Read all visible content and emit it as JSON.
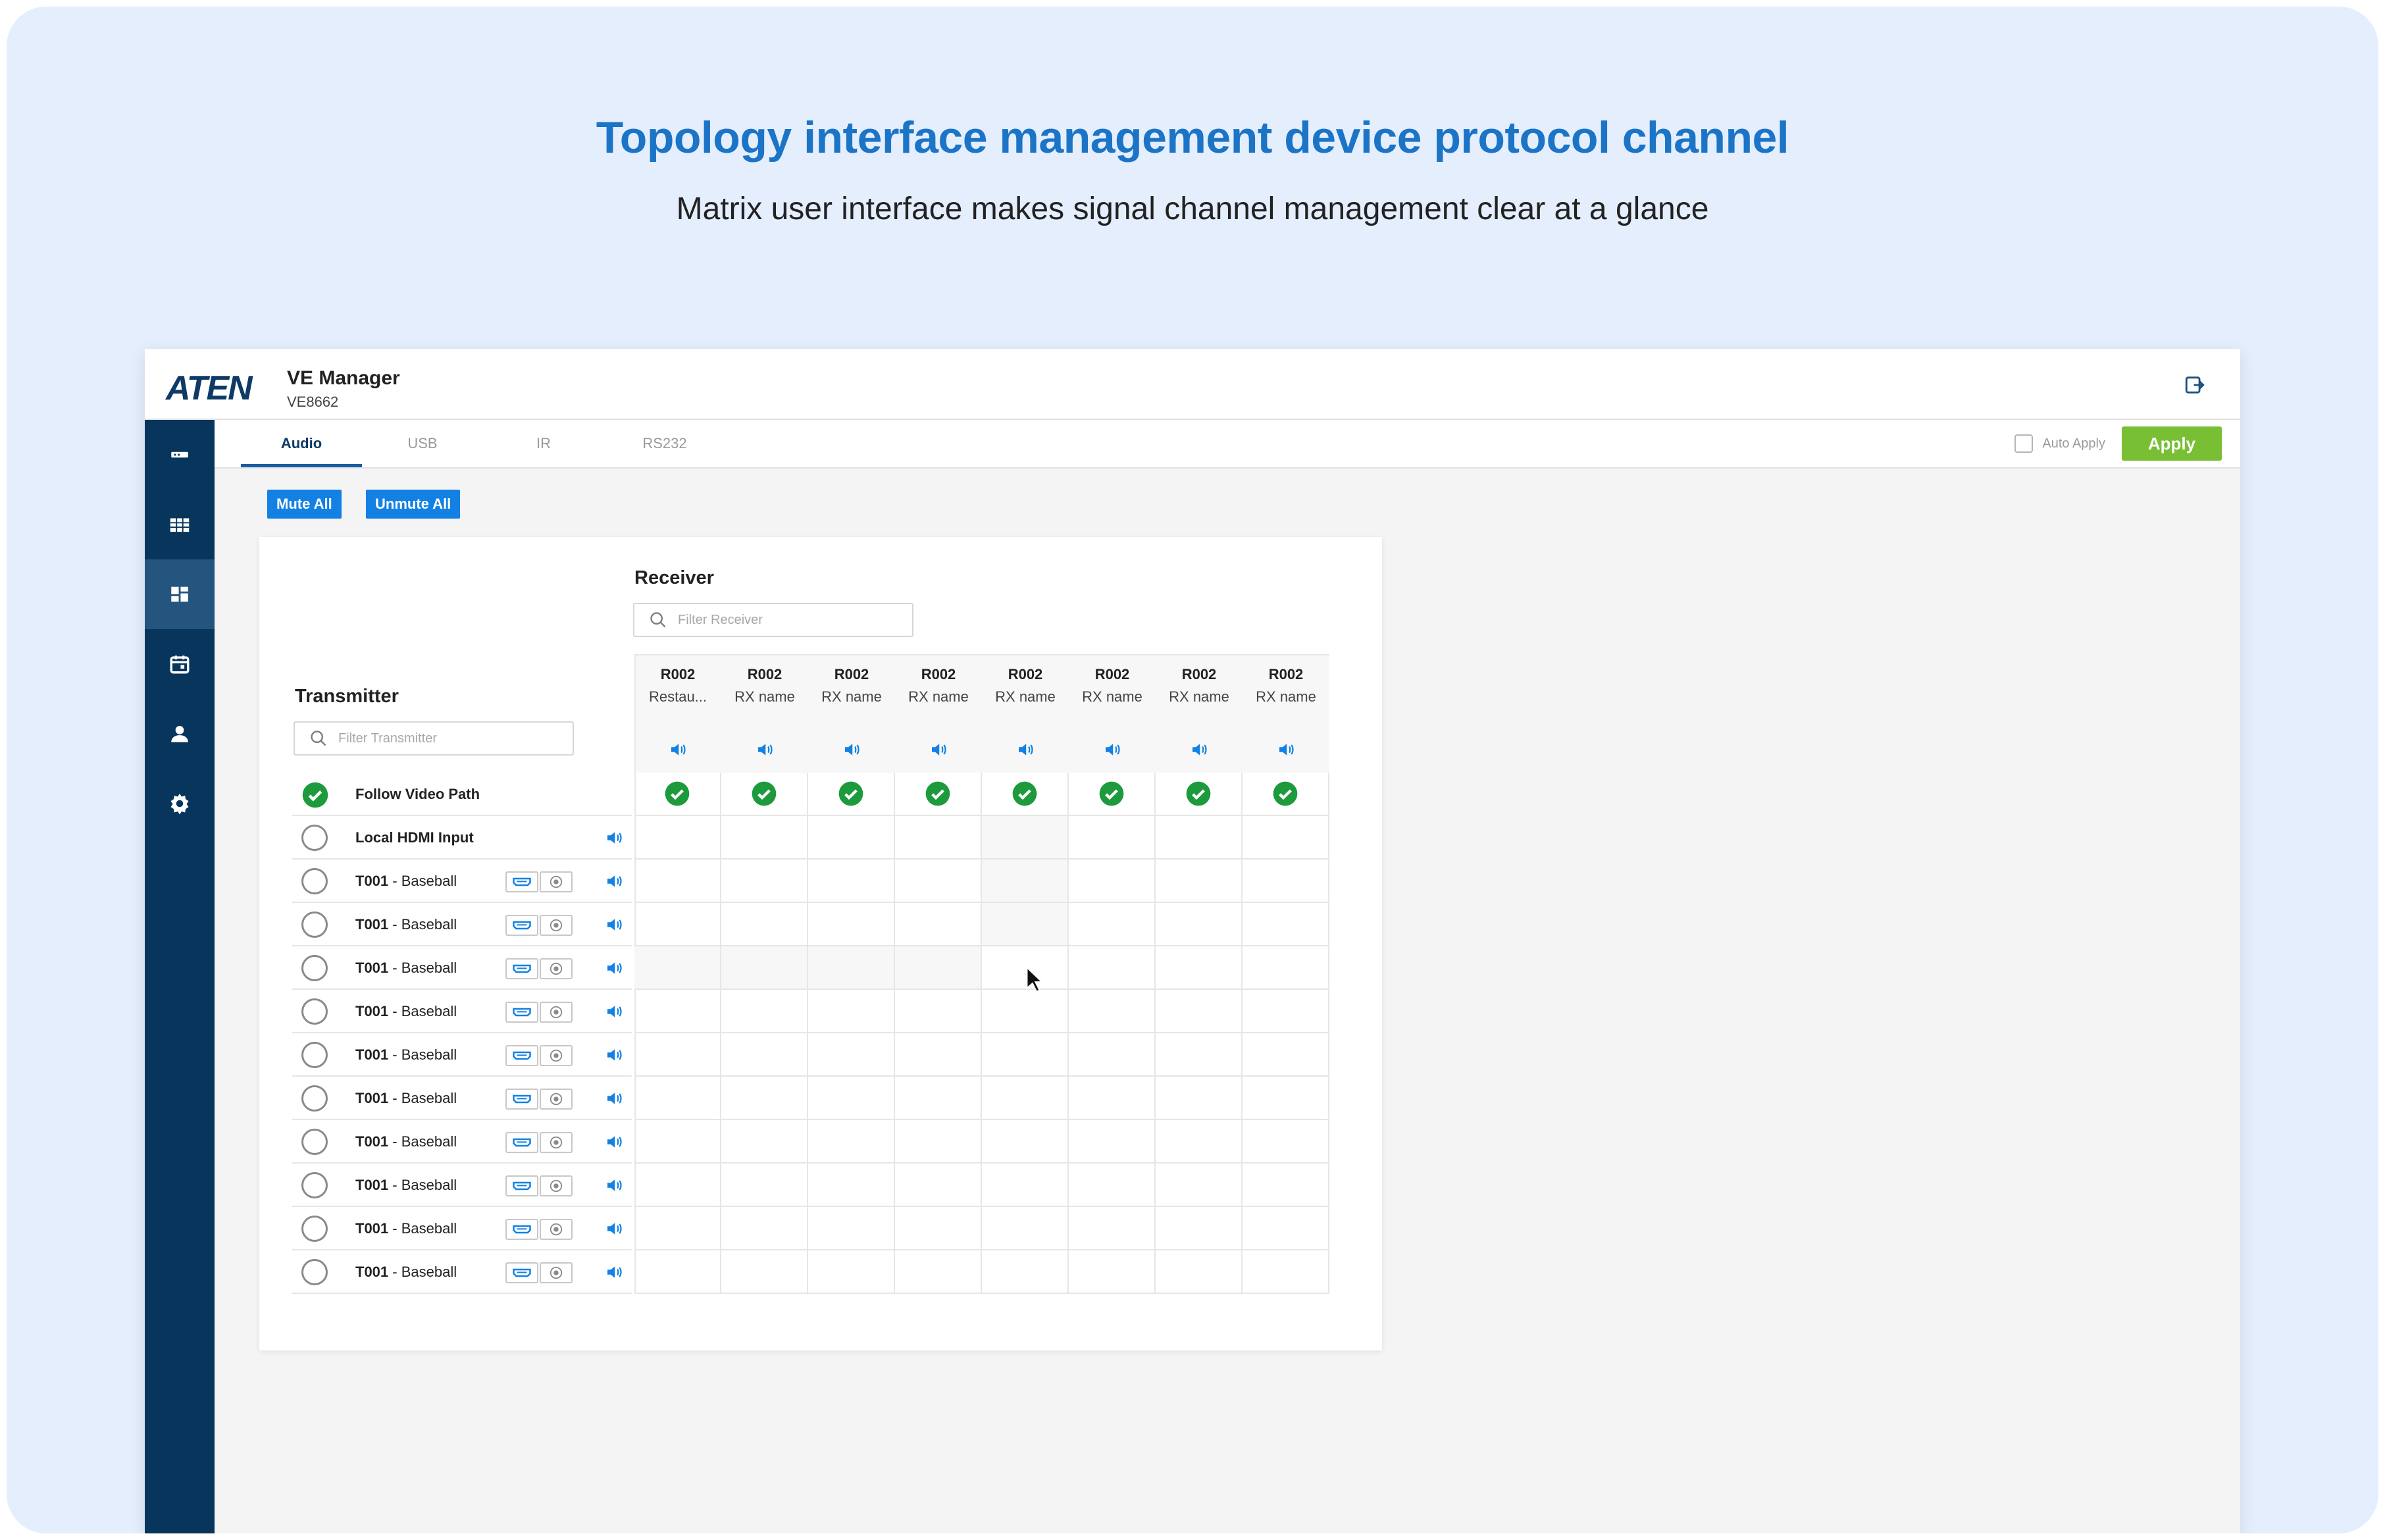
{
  "hero": {
    "title": "Topology interface management device protocol channel",
    "subtitle": "Matrix user interface makes signal channel management clear at a glance"
  },
  "header": {
    "logo": "ATEN",
    "app_name": "VE Manager",
    "model": "VE8662",
    "logout_icon": "logout-icon"
  },
  "sidebar": {
    "items": [
      {
        "icon": "device-icon",
        "active": false
      },
      {
        "icon": "grid-icon",
        "active": false
      },
      {
        "icon": "matrix-icon",
        "active": true
      },
      {
        "icon": "calendar-icon",
        "active": false
      },
      {
        "icon": "user-icon",
        "active": false
      },
      {
        "icon": "gear-icon",
        "active": false
      }
    ]
  },
  "tabs": {
    "items": [
      {
        "label": "Audio",
        "active": true
      },
      {
        "label": "USB",
        "active": false
      },
      {
        "label": "IR",
        "active": false
      },
      {
        "label": "RS232",
        "active": false
      }
    ],
    "auto_apply_label": "Auto Apply",
    "auto_apply_checked": false,
    "apply_label": "Apply"
  },
  "toolbar": {
    "mute_all_label": "Mute All",
    "unmute_all_label": "Unmute All"
  },
  "matrix": {
    "receiver_label": "Receiver",
    "receiver_filter_placeholder": "Filter Receiver",
    "transmitter_label": "Transmitter",
    "transmitter_filter_placeholder": "Filter Transmitter",
    "receivers": [
      {
        "id": "R002",
        "name": "Restau..."
      },
      {
        "id": "R002",
        "name": "RX name"
      },
      {
        "id": "R002",
        "name": "RX name"
      },
      {
        "id": "R002",
        "name": "RX name"
      },
      {
        "id": "R002",
        "name": "RX name"
      },
      {
        "id": "R002",
        "name": "RX name"
      },
      {
        "id": "R002",
        "name": "RX name"
      },
      {
        "id": "R002",
        "name": "RX name"
      }
    ],
    "follow_video_path": {
      "label": "Follow Video Path",
      "selected": true
    },
    "local_input": {
      "label": "Local HDMI Input"
    },
    "transmitters": [
      {
        "id": "T001",
        "name": " - Baseball"
      },
      {
        "id": "T001",
        "name": " - Baseball"
      },
      {
        "id": "T001",
        "name": " - Baseball"
      },
      {
        "id": "T001",
        "name": " - Baseball"
      },
      {
        "id": "T001",
        "name": " - Baseball"
      },
      {
        "id": "T001",
        "name": " - Baseball"
      },
      {
        "id": "T001",
        "name": " - Baseball"
      },
      {
        "id": "T001",
        "name": " - Baseball"
      },
      {
        "id": "T001",
        "name": " - Baseball"
      },
      {
        "id": "T001",
        "name": " - Baseball"
      }
    ],
    "colors": {
      "accent": "#1281e3",
      "check": "#1c9a3c",
      "apply": "#78bf33",
      "sidebar": "#07355c"
    }
  }
}
